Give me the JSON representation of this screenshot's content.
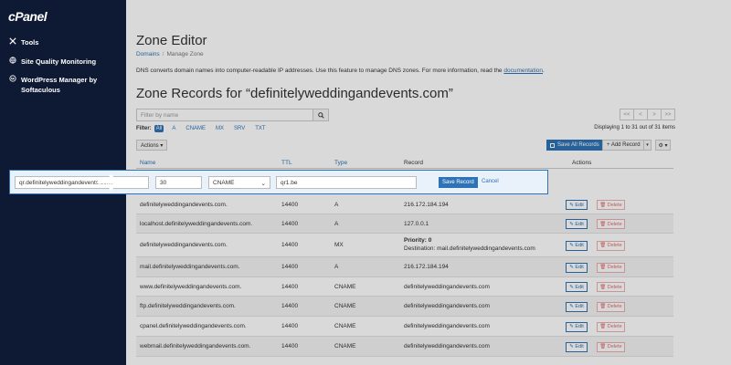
{
  "sidebar": {
    "logo": "cPanel",
    "items": [
      {
        "label": "Tools",
        "icon": "tools-icon"
      },
      {
        "label": "Site Quality Monitoring",
        "icon": "globe-icon"
      },
      {
        "label": "WordPress Manager by Softaculous",
        "icon": "wordpress-icon"
      }
    ]
  },
  "page": {
    "title": "Zone Editor",
    "breadcrumb": [
      "Domains",
      "Manage Zone"
    ],
    "description": "DNS converts domain names into computer-readable IP addresses. Use this feature to manage DNS zones. For more information, read the ",
    "description_link": "documentation",
    "description_end": ".",
    "records_title": "Zone Records for “definitelyweddingandevents.com”"
  },
  "search": {
    "placeholder": "Filter by name"
  },
  "filter": {
    "label": "Filter:",
    "options": [
      "All",
      "A",
      "CNAME",
      "MX",
      "SRV",
      "TXT"
    ],
    "active": "All"
  },
  "pager": {
    "first": "<<",
    "prev": "<",
    "next": ">",
    "last": ">>"
  },
  "displaying": "Displaying 1 to 31 out of 31 items",
  "toolbar": {
    "actions": "Actions ▾",
    "save_all": "Save All Records",
    "add_record": "+ Add Record",
    "add_caret": "▾",
    "gear": "⚙ ▾"
  },
  "table": {
    "headers": {
      "name": "Name",
      "ttl": "TTL",
      "type": "Type",
      "record": "Record",
      "actions": "Actions"
    },
    "edit_row": {
      "name": "qr.definitelyweddingandevents.com.",
      "ttl": "30",
      "type": "CNAME",
      "record": "qr1.be",
      "save": "Save Record",
      "cancel": "Cancel"
    },
    "rows": [
      {
        "name": "definitelyweddingandevents.com.",
        "ttl": "14400",
        "type": "A",
        "record": "216.172.184.194",
        "record2": ""
      },
      {
        "name": "localhost.definitelyweddingandevents.com.",
        "ttl": "14400",
        "type": "A",
        "record": "127.0.0.1",
        "record2": ""
      },
      {
        "name": "definitelyweddingandevents.com.",
        "ttl": "14400",
        "type": "MX",
        "record": "Priority: 0",
        "record2": "Destination: mail.definitelyweddingandevents.com"
      },
      {
        "name": "mail.definitelyweddingandevents.com.",
        "ttl": "14400",
        "type": "A",
        "record": "216.172.184.194",
        "record2": ""
      },
      {
        "name": "www.definitelyweddingandevents.com.",
        "ttl": "14400",
        "type": "CNAME",
        "record": "definitelyweddingandevents.com",
        "record2": ""
      },
      {
        "name": "ftp.definitelyweddingandevents.com.",
        "ttl": "14400",
        "type": "CNAME",
        "record": "definitelyweddingandevents.com",
        "record2": ""
      },
      {
        "name": "cpanel.definitelyweddingandevents.com.",
        "ttl": "14400",
        "type": "CNAME",
        "record": "definitelyweddingandevents.com",
        "record2": ""
      },
      {
        "name": "webmail.definitelyweddingandevents.com.",
        "ttl": "14400",
        "type": "CNAME",
        "record": "definitelyweddingandevents.com",
        "record2": ""
      }
    ],
    "edit_label": "✎ Edit",
    "delete_label": "🗑 Delete"
  },
  "colors": {
    "sidebar": "#0e1a33",
    "accent": "#2d73b6",
    "danger": "#d9534f"
  }
}
